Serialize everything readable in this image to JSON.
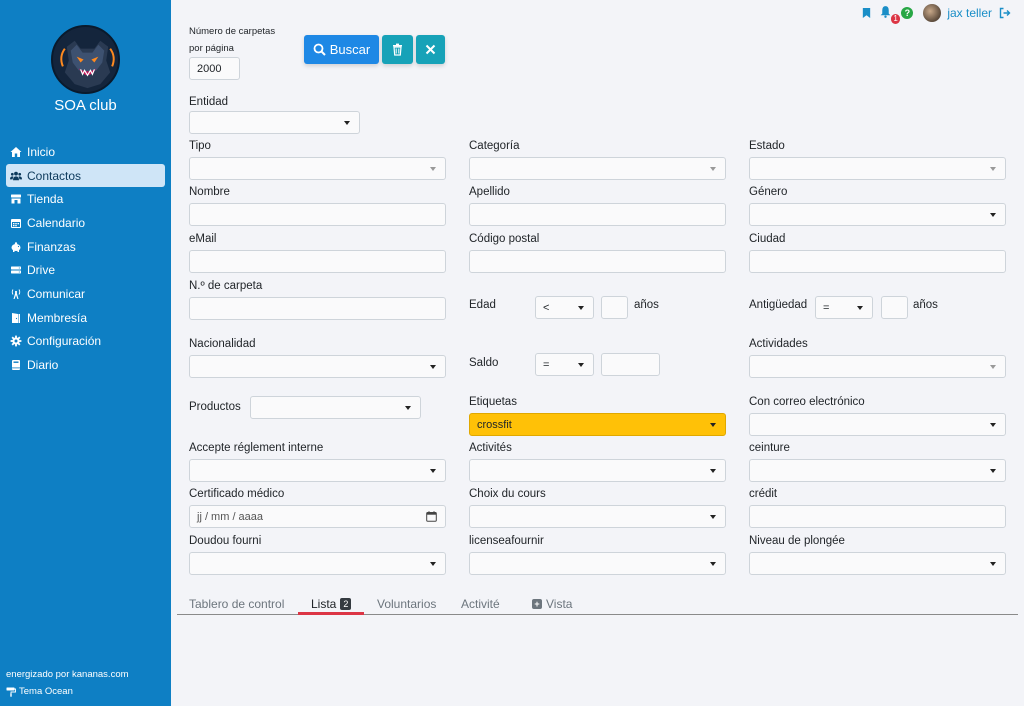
{
  "sidebar": {
    "club_name": "SOA club",
    "items": [
      {
        "label": "Inicio",
        "icon": "home-icon"
      },
      {
        "label": "Contactos",
        "icon": "users-icon",
        "active": true
      },
      {
        "label": "Tienda",
        "icon": "store-icon"
      },
      {
        "label": "Calendario",
        "icon": "calendar-icon"
      },
      {
        "label": "Finanzas",
        "icon": "piggy-bank-icon"
      },
      {
        "label": "Drive",
        "icon": "drive-icon"
      },
      {
        "label": "Comunicar",
        "icon": "broadcast-icon"
      },
      {
        "label": "Membresía",
        "icon": "door-icon"
      },
      {
        "label": "Configuración",
        "icon": "gear-icon"
      },
      {
        "label": "Diario",
        "icon": "book-icon"
      }
    ],
    "powered_by": "energizado por kananas.com",
    "theme": "Tema Ocean"
  },
  "topbar": {
    "notification_count": "1",
    "help_symbol": "?",
    "user_name": "jax teller"
  },
  "toolbar": {
    "per_page_label_1": "Número de carpetas",
    "per_page_label_2": "por página",
    "per_page_value": "2000",
    "search_label": "Buscar"
  },
  "form": {
    "entidad": {
      "label": "Entidad",
      "value": ""
    },
    "tipo": {
      "label": "Tipo",
      "value": ""
    },
    "categoria": {
      "label": "Categoría",
      "value": ""
    },
    "estado": {
      "label": "Estado",
      "value": ""
    },
    "nombre": {
      "label": "Nombre",
      "value": ""
    },
    "apellido": {
      "label": "Apellido",
      "value": ""
    },
    "genero": {
      "label": "Género",
      "value": ""
    },
    "email": {
      "label": "eMail",
      "value": ""
    },
    "codigo_postal": {
      "label": "Código postal",
      "value": ""
    },
    "ciudad": {
      "label": "Ciudad",
      "value": ""
    },
    "n_carpeta": {
      "label": "N.º de carpeta",
      "value": ""
    },
    "edad": {
      "label": "Edad",
      "operator": "<",
      "value": "",
      "unit": "años"
    },
    "antiguedad": {
      "label": "Antigüedad",
      "operator": "=",
      "value": "",
      "unit": "años"
    },
    "nacionalidad": {
      "label": "Nacionalidad",
      "value": ""
    },
    "saldo": {
      "label": "Saldo",
      "operator": "=",
      "value": ""
    },
    "actividades": {
      "label": "Actividades",
      "value": ""
    },
    "productos": {
      "label": "Productos",
      "value": ""
    },
    "etiquetas": {
      "label": "Etiquetas",
      "value": "crossfit"
    },
    "con_correo": {
      "label": "Con correo electrónico",
      "value": ""
    },
    "accepte": {
      "label": "Accepte réglement interne",
      "value": ""
    },
    "activites": {
      "label": "Activités",
      "value": ""
    },
    "ceinture": {
      "label": "ceinture",
      "value": ""
    },
    "certificado": {
      "label": "Certificado médico",
      "placeholder": "jj / mm / aaaa"
    },
    "choix": {
      "label": "Choix du cours",
      "value": ""
    },
    "credit": {
      "label": "crédit",
      "value": ""
    },
    "doudou": {
      "label": "Doudou fourni",
      "value": ""
    },
    "license": {
      "label": "licenseafournir",
      "value": ""
    },
    "niveau": {
      "label": "Niveau de plongée",
      "value": ""
    }
  },
  "tabs": [
    {
      "label": "Tablero de control"
    },
    {
      "label": "Lista",
      "badge": "2",
      "active": true
    },
    {
      "label": "Voluntarios"
    },
    {
      "label": "Activité"
    },
    {
      "label": "Vista"
    }
  ],
  "colors": {
    "sidebar": "#0e7fc4",
    "primary": "#1e88e5",
    "teal": "#17a2b8",
    "tag_highlight": "#ffc107",
    "tab_underline": "#dc3545"
  }
}
